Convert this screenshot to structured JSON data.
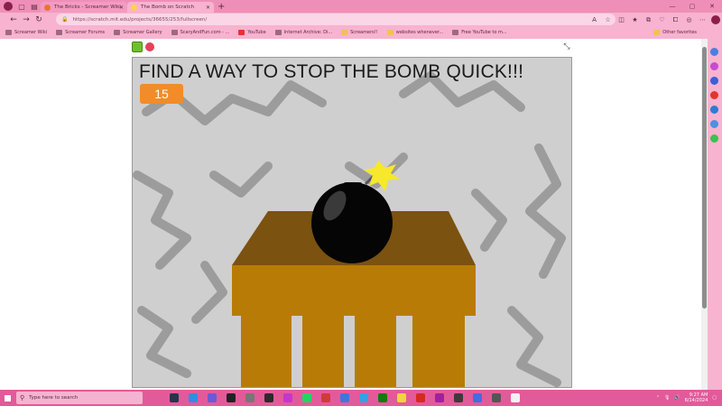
{
  "browser": {
    "tabs": [
      {
        "label": "The Bricks - Screamer Wiki",
        "active": false
      },
      {
        "label": "The Bomb on Scratch",
        "active": true
      }
    ],
    "url": "https://scratch.mit.edu/projects/36655/253/fullscreen/",
    "bookmarks": [
      "Screamer Wiki",
      "Screamer Forums",
      "Screamer Gallery",
      "ScaryAndFun.com - ...",
      "YouTube",
      "Internet Archive: Di...",
      "Screamers!!",
      "websites whenever...",
      "Free YouTube to m..."
    ],
    "other_favorites": "Other favorites"
  },
  "scratch": {
    "title": "FIND A WAY TO STOP THE BOMB QUICK!!!",
    "timer": "15"
  },
  "taskbar": {
    "search_placeholder": "Type here to search",
    "time": "9:27 AM",
    "date": "6/14/2024"
  },
  "colors": {
    "stage_bg": "#cfcfcf",
    "table_top": "#7b5210",
    "table_front": "#b87c06",
    "counter": "#f28c28",
    "taskbar": "#e35a9a",
    "browser_chrome": "#f7b3cf"
  }
}
